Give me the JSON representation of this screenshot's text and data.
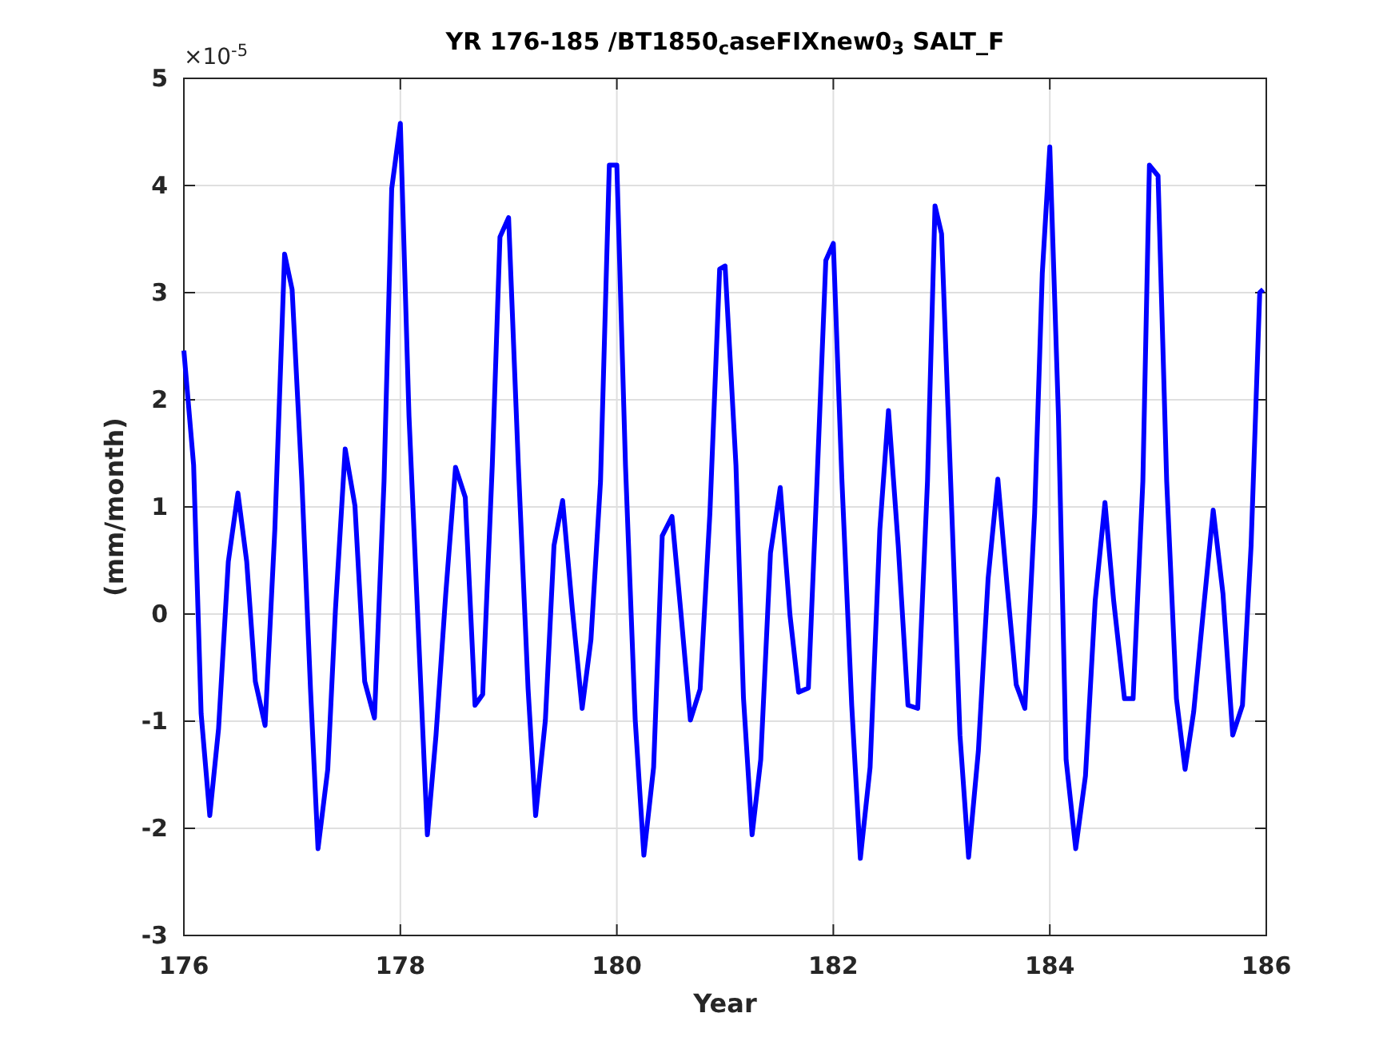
{
  "figure": {
    "title": "YR 176-185 /BT1850$_{c}$aseFIXnew0$_{3}$ SALT_F",
    "y_exponent": "×10$^{-5}$",
    "chart_data": {
      "type": "line",
      "xlabel": "Year",
      "ylabel": "(mm/month)",
      "x": [
        176.0,
        176.09,
        176.16,
        176.24,
        176.32,
        176.41,
        176.5,
        176.58,
        176.66,
        176.75,
        176.84,
        176.93,
        177.0,
        177.09,
        177.17,
        177.24,
        177.33,
        177.4,
        177.49,
        177.58,
        177.67,
        177.76,
        177.85,
        177.92,
        178.0,
        178.08,
        178.17,
        178.25,
        178.33,
        178.42,
        178.51,
        178.6,
        178.69,
        178.76,
        178.85,
        178.92,
        179.0,
        179.09,
        179.18,
        179.25,
        179.34,
        179.42,
        179.5,
        179.59,
        179.68,
        179.76,
        179.85,
        179.93,
        180.0,
        180.08,
        180.17,
        180.25,
        180.34,
        180.42,
        180.51,
        180.59,
        180.68,
        180.77,
        180.86,
        180.95,
        181.0,
        181.1,
        181.17,
        181.25,
        181.33,
        181.42,
        181.51,
        181.6,
        181.68,
        181.77,
        181.85,
        181.93,
        182.0,
        182.08,
        182.17,
        182.25,
        182.34,
        182.43,
        182.51,
        182.6,
        182.69,
        182.78,
        182.87,
        182.94,
        183.0,
        183.1,
        183.17,
        183.25,
        183.34,
        183.43,
        183.52,
        183.6,
        183.69,
        183.77,
        183.86,
        183.93,
        184.0,
        184.08,
        184.15,
        184.24,
        184.33,
        184.42,
        184.51,
        184.59,
        184.69,
        184.77,
        184.86,
        184.92,
        185.0,
        185.08,
        185.17,
        185.25,
        185.33,
        185.42,
        185.51,
        185.6,
        185.69,
        185.78,
        185.86,
        185.94,
        185.97
      ],
      "series": [
        {
          "color": "#0000ff",
          "values": [
            2.46,
            1.39,
            -0.93,
            -1.88,
            -1.07,
            0.49,
            1.13,
            0.49,
            -0.63,
            -1.04,
            0.79,
            3.36,
            3.03,
            1.24,
            -0.7,
            -2.19,
            -1.45,
            0.04,
            1.54,
            1.01,
            -0.63,
            -0.97,
            1.24,
            3.97,
            4.58,
            1.85,
            -0.24,
            -2.06,
            -1.13,
            0.19,
            1.37,
            1.09,
            -0.85,
            -0.75,
            1.39,
            3.52,
            3.7,
            1.39,
            -0.7,
            -1.88,
            -0.99,
            0.64,
            1.06,
            0.04,
            -0.88,
            -0.24,
            1.24,
            4.19,
            4.19,
            1.39,
            -0.99,
            -2.25,
            -1.43,
            0.73,
            0.91,
            0.04,
            -0.99,
            -0.7,
            0.94,
            3.22,
            3.25,
            1.39,
            -0.78,
            -2.06,
            -1.36,
            0.57,
            1.18,
            -0.01,
            -0.73,
            -0.69,
            1.24,
            3.3,
            3.46,
            1.24,
            -0.85,
            -2.28,
            -1.43,
            0.79,
            1.9,
            0.64,
            -0.85,
            -0.88,
            1.24,
            3.81,
            3.55,
            0.79,
            -1.13,
            -2.27,
            -1.28,
            0.33,
            1.26,
            0.33,
            -0.66,
            -0.88,
            0.94,
            3.18,
            4.36,
            1.85,
            -1.36,
            -2.19,
            -1.51,
            0.13,
            1.04,
            0.13,
            -0.79,
            -0.79,
            1.24,
            4.19,
            4.09,
            1.24,
            -0.79,
            -1.45,
            -0.91,
            0.04,
            0.97,
            0.19,
            -1.13,
            -0.85,
            0.64,
            3.0,
            3.03
          ]
        }
      ],
      "xlim": [
        176,
        186
      ],
      "ylim": [
        -3,
        5
      ],
      "xticks": [
        176,
        178,
        180,
        182,
        184,
        186
      ],
      "yticks": [
        -3,
        -2,
        -1,
        0,
        1,
        2,
        3,
        4,
        5
      ],
      "grid": true
    }
  }
}
